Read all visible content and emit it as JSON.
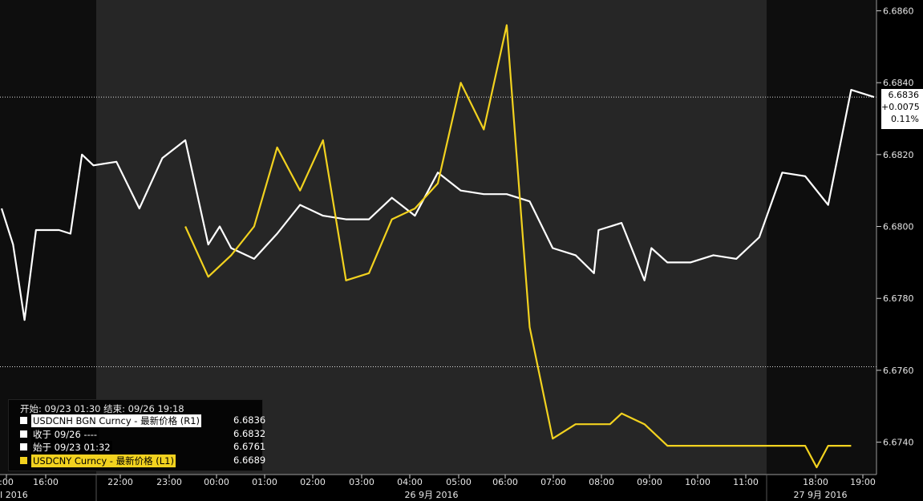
{
  "chart_data": {
    "type": "line",
    "y_axis": {
      "ticks": [
        "6.6860",
        "6.6840",
        "6.6820",
        "6.6800",
        "6.6780",
        "6.6760",
        "6.6740"
      ],
      "range": [
        6.6731,
        6.6863
      ]
    },
    "x_axis": {
      "ticks": [
        ":00",
        "16:00",
        "22:00",
        "23:00",
        "00:00",
        "01:00",
        "02:00",
        "03:00",
        "04:00",
        "05:00",
        "06:00",
        "07:00",
        "08:00",
        "09:00",
        "10:00",
        "11:00",
        "18:00",
        "19:00"
      ],
      "date_labels": [
        "I 2016",
        "26 9月 2016",
        "27 9月 2016"
      ]
    },
    "reference_lines": [
      6.6836,
      6.6761
    ],
    "series": [
      {
        "name": "USDCNH BGN Curncy - 最新价格 (R1)",
        "color": "#ffffff",
        "x": [
          0.0,
          0.5,
          1.0,
          1.5,
          2.0,
          2.5,
          3.0,
          3.5,
          4.0,
          5.0,
          6.0,
          7.0,
          8.0,
          9.0,
          9.5,
          10.0,
          11.0,
          12.0,
          13.0,
          14.0,
          15.0,
          16.0,
          17.0,
          18.0,
          19.0,
          20.0,
          21.0,
          22.0,
          23.0,
          24.0,
          25.0,
          25.8,
          26.0,
          27.0,
          28.0,
          28.3,
          29.0,
          30.0,
          31.0,
          32.0,
          33.0,
          34.0,
          35.0,
          36.0,
          37.0,
          38.0
        ],
        "y": [
          6.6805,
          6.6795,
          6.6774,
          6.6799,
          6.6799,
          6.6799,
          6.6798,
          6.682,
          6.6817,
          6.6818,
          6.6805,
          6.6819,
          6.6824,
          6.6795,
          6.68,
          6.6794,
          6.6791,
          6.6798,
          6.6806,
          6.6803,
          6.6802,
          6.6802,
          6.6808,
          6.6803,
          6.6815,
          6.681,
          6.6809,
          6.6809,
          6.6807,
          6.6794,
          6.6792,
          6.6787,
          6.6799,
          6.6801,
          6.6785,
          6.6794,
          6.679,
          6.679,
          6.6792,
          6.6791,
          6.6797,
          6.6815,
          6.6814,
          6.6806,
          6.6838,
          6.6836
        ]
      },
      {
        "name": "USDCNY Curncy - 最新价格 (L1)",
        "color": "#f2d21f",
        "x": [
          8.0,
          9.0,
          10.0,
          11.0,
          12.0,
          13.0,
          14.0,
          15.0,
          16.0,
          17.0,
          18.0,
          19.0,
          20.0,
          21.0,
          22.0,
          23.0,
          24.0,
          25.0,
          25.5,
          26.0,
          26.5,
          27.0,
          28.0,
          29.0,
          30.0,
          31.0,
          32.0,
          33.0,
          34.0,
          35.0,
          35.5,
          36.0,
          37.0
        ],
        "y": [
          6.68,
          6.6786,
          6.6792,
          6.68,
          6.6822,
          6.681,
          6.6824,
          6.6785,
          6.6787,
          6.6802,
          6.6805,
          6.6812,
          6.684,
          6.6827,
          6.6856,
          6.6772,
          6.6741,
          6.6745,
          6.6745,
          6.6745,
          6.6745,
          6.6748,
          6.6745,
          6.6739,
          6.6739,
          6.6739,
          6.6739,
          6.6739,
          6.6739,
          6.6739,
          6.6733,
          6.6739,
          6.6739
        ]
      }
    ],
    "legend": {
      "header": "开始: 09/23 01:30 结束: 09/26 19:18",
      "rows": [
        {
          "label": "USDCNH BGN Curncy - 最新价格 (R1)",
          "value": "6.6836",
          "color": "#ffffff",
          "style": "box"
        },
        {
          "label": "收于 09/26 ----",
          "value": "6.6832",
          "color": "#ffffff",
          "style": "boxk"
        },
        {
          "label": "始于 09/23 01:32",
          "value": "6.6761",
          "color": "#ffffff",
          "style": "boxk"
        },
        {
          "label": "USDCNY Curncy - 最新价格 (L1)",
          "value": "6.6689",
          "color": "#f2d21f",
          "style": "boxy"
        }
      ]
    },
    "last_value_tag": {
      "value": "6.6836",
      "change": "+0.0075",
      "pct": "0.11%"
    }
  }
}
